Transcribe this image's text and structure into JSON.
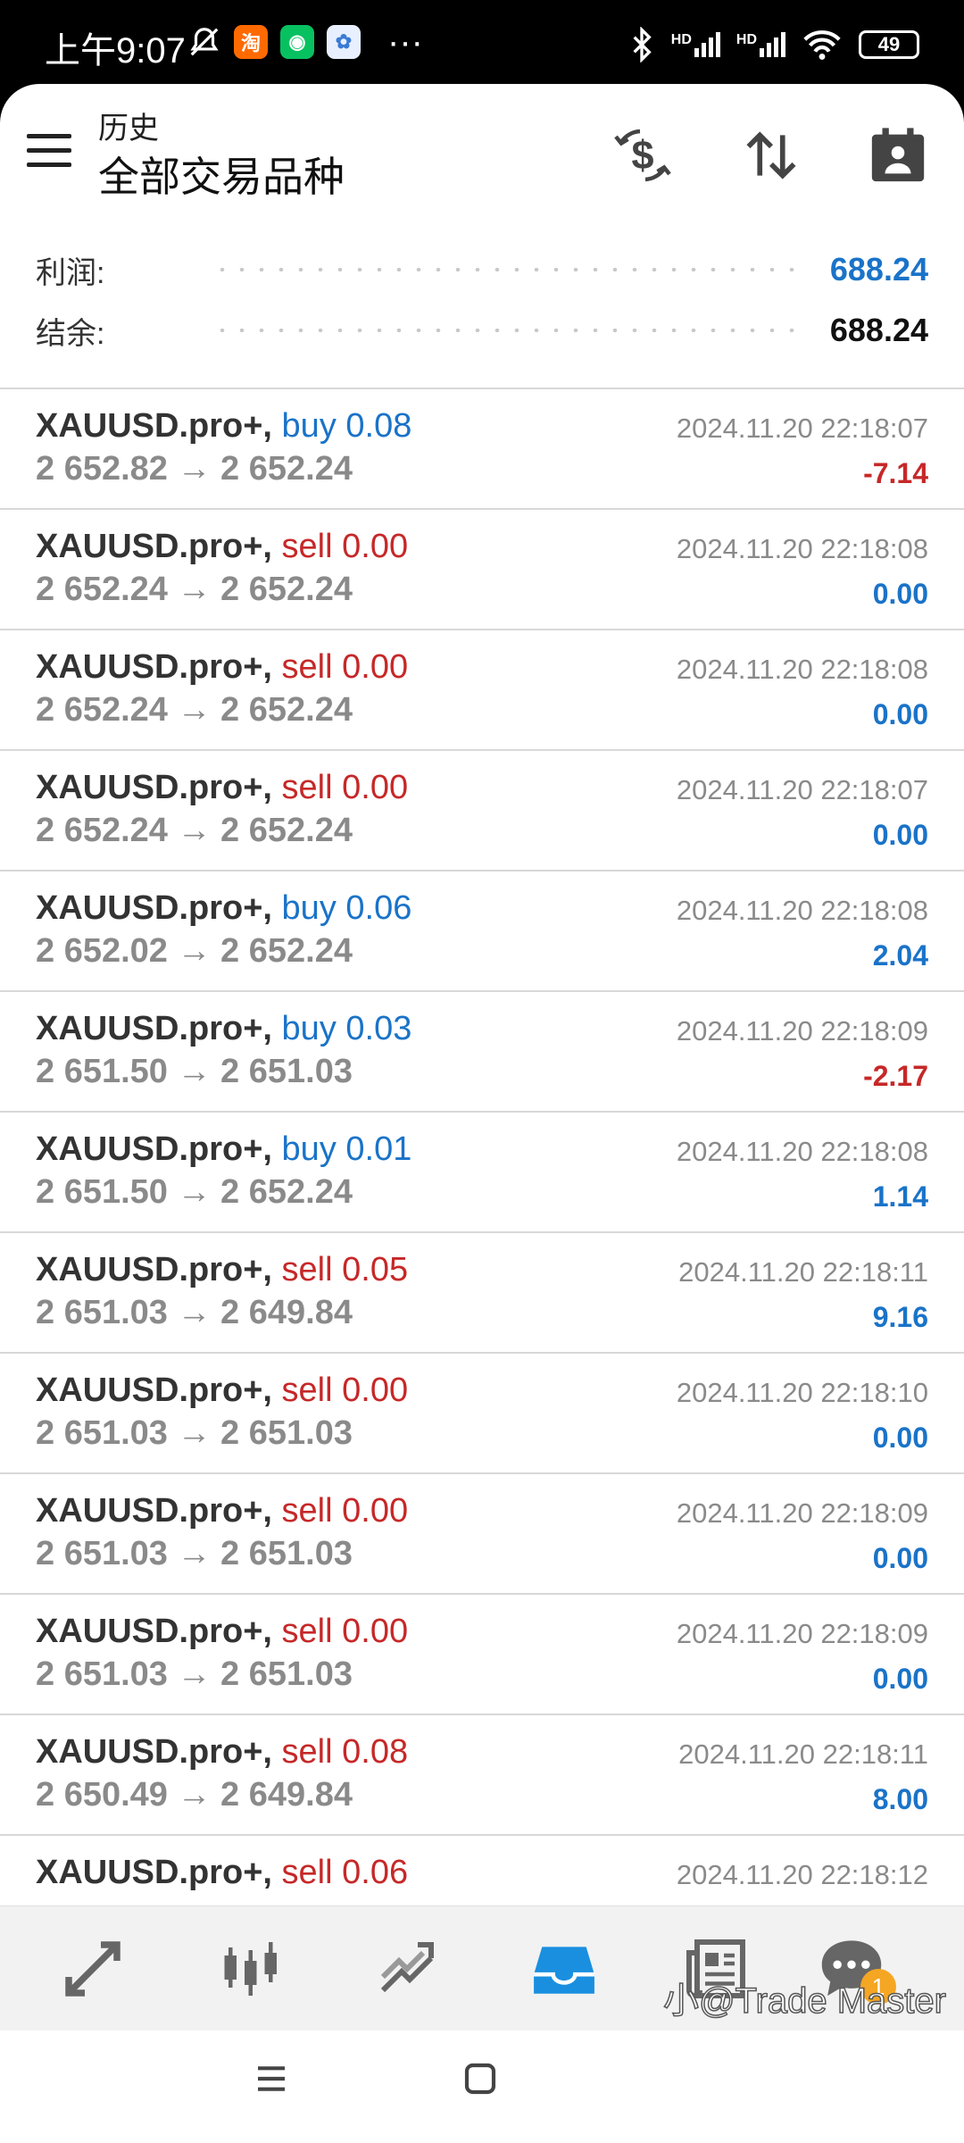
{
  "status_bar": {
    "time": "上午9:07",
    "battery": "49",
    "network1": "HD",
    "network2": "HD",
    "app_icons": [
      "notification-muted-icon",
      "taobao-icon",
      "wechat-icon",
      "app-icon"
    ],
    "overflow": "···"
  },
  "toolbar": {
    "subtitle": "历史",
    "title": "全部交易品种",
    "icons": [
      "menu-icon",
      "currency-exchange-icon",
      "sort-icon",
      "calendar-icon"
    ]
  },
  "summary": {
    "profit_label": "利润:",
    "profit_value": "688.24",
    "balance_label": "结余:",
    "balance_value": "688.24"
  },
  "deals": [
    {
      "symbol": "XAUUSD.pro+,",
      "type": "buy",
      "volume": "0.08",
      "open": "2 652.82",
      "close": "2 652.24",
      "time": "2024.11.20 22:18:07",
      "profit": "-7.14"
    },
    {
      "symbol": "XAUUSD.pro+,",
      "type": "sell",
      "volume": "0.00",
      "open": "2 652.24",
      "close": "2 652.24",
      "time": "2024.11.20 22:18:08",
      "profit": "0.00"
    },
    {
      "symbol": "XAUUSD.pro+,",
      "type": "sell",
      "volume": "0.00",
      "open": "2 652.24",
      "close": "2 652.24",
      "time": "2024.11.20 22:18:08",
      "profit": "0.00"
    },
    {
      "symbol": "XAUUSD.pro+,",
      "type": "sell",
      "volume": "0.00",
      "open": "2 652.24",
      "close": "2 652.24",
      "time": "2024.11.20 22:18:07",
      "profit": "0.00"
    },
    {
      "symbol": "XAUUSD.pro+,",
      "type": "buy",
      "volume": "0.06",
      "open": "2 652.02",
      "close": "2 652.24",
      "time": "2024.11.20 22:18:08",
      "profit": "2.04"
    },
    {
      "symbol": "XAUUSD.pro+,",
      "type": "buy",
      "volume": "0.03",
      "open": "2 651.50",
      "close": "2 651.03",
      "time": "2024.11.20 22:18:09",
      "profit": "-2.17"
    },
    {
      "symbol": "XAUUSD.pro+,",
      "type": "buy",
      "volume": "0.01",
      "open": "2 651.50",
      "close": "2 652.24",
      "time": "2024.11.20 22:18:08",
      "profit": "1.14"
    },
    {
      "symbol": "XAUUSD.pro+,",
      "type": "sell",
      "volume": "0.05",
      "open": "2 651.03",
      "close": "2 649.84",
      "time": "2024.11.20 22:18:11",
      "profit": "9.16"
    },
    {
      "symbol": "XAUUSD.pro+,",
      "type": "sell",
      "volume": "0.00",
      "open": "2 651.03",
      "close": "2 651.03",
      "time": "2024.11.20 22:18:10",
      "profit": "0.00"
    },
    {
      "symbol": "XAUUSD.pro+,",
      "type": "sell",
      "volume": "0.00",
      "open": "2 651.03",
      "close": "2 651.03",
      "time": "2024.11.20 22:18:09",
      "profit": "0.00"
    },
    {
      "symbol": "XAUUSD.pro+,",
      "type": "sell",
      "volume": "0.00",
      "open": "2 651.03",
      "close": "2 651.03",
      "time": "2024.11.20 22:18:09",
      "profit": "0.00"
    },
    {
      "symbol": "XAUUSD.pro+,",
      "type": "sell",
      "volume": "0.08",
      "open": "2 650.49",
      "close": "2 649.84",
      "time": "2024.11.20 22:18:11",
      "profit": "8.00"
    },
    {
      "symbol": "XAUUSD.pro+,",
      "type": "sell",
      "volume": "0.06",
      "open": "",
      "close": "",
      "time": "2024.11.20 22:18:12",
      "profit": ""
    }
  ],
  "bottom_nav": {
    "items": [
      "quotes-icon",
      "chart-icon",
      "trade-icon",
      "history-icon",
      "news-icon",
      "chat-icon"
    ],
    "active": "history-icon",
    "chat_badge": "1"
  },
  "colors": {
    "buy": "#1a73c8",
    "sell": "#c62828",
    "accent": "#1a73c8",
    "badge": "#f5a623"
  },
  "watermark": "小@Trade Master"
}
